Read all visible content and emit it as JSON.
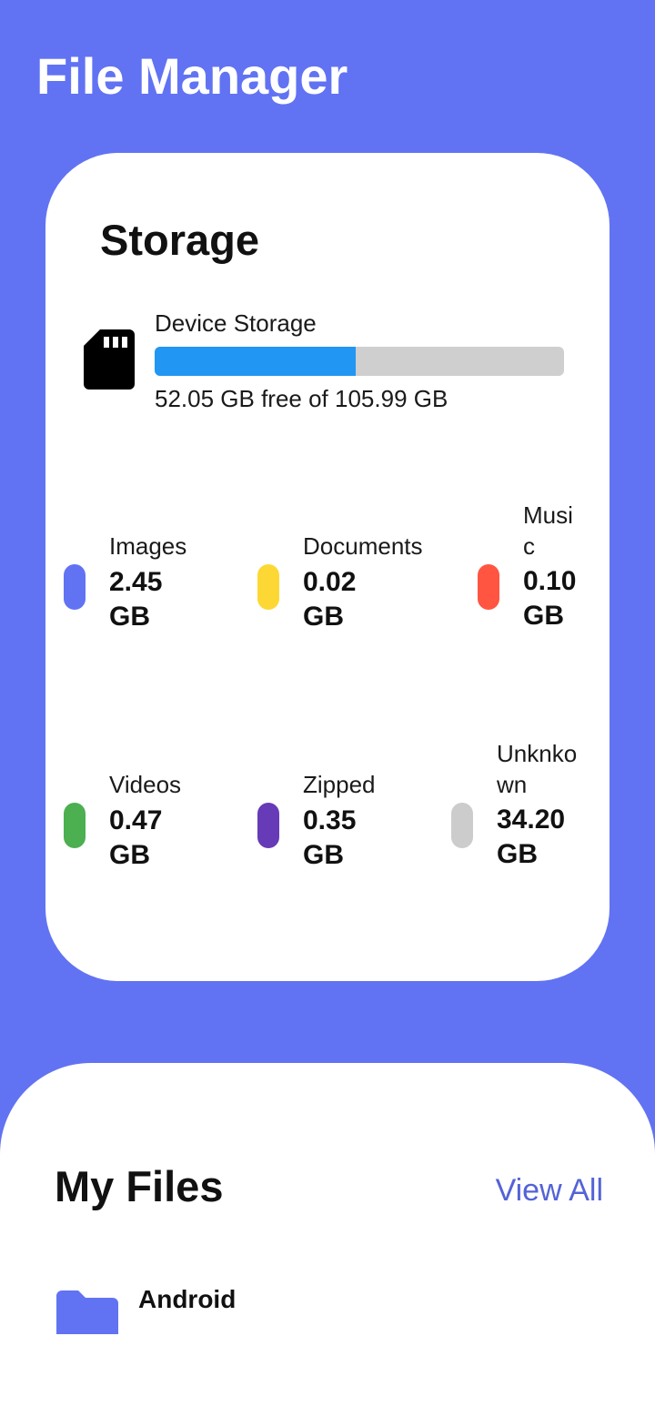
{
  "app": {
    "title": "File Manager"
  },
  "storage": {
    "title": "Storage",
    "device_label": "Device Storage",
    "free_text": "52.05 GB free of 105.99 GB",
    "used_fraction": 0.49,
    "bar_color": "#2196F3",
    "track_color": "#CFCFCF",
    "icon": "sd-card-icon"
  },
  "categories": [
    {
      "label": "Images",
      "size": "2.45 GB",
      "color": "#6173F3"
    },
    {
      "label": "Documents",
      "size": "0.02 GB",
      "color": "#FDD835"
    },
    {
      "label": "Music",
      "size": "0.10 GB",
      "color": "#FF5541"
    },
    {
      "label": "Videos",
      "size": "0.47 GB",
      "color": "#4CAF50"
    },
    {
      "label": "Zipped",
      "size": "0.35 GB",
      "color": "#673AB7"
    },
    {
      "label": "Unknkown",
      "size": "34.20 GB",
      "color": "#CCCCCC"
    }
  ],
  "my_files": {
    "title": "My Files",
    "view_all_label": "View All",
    "folders": [
      {
        "name": "Android",
        "icon": "folder-icon"
      }
    ]
  },
  "colors": {
    "background": "#6173F3",
    "card": "#FFFFFF",
    "link": "#5463D6"
  }
}
